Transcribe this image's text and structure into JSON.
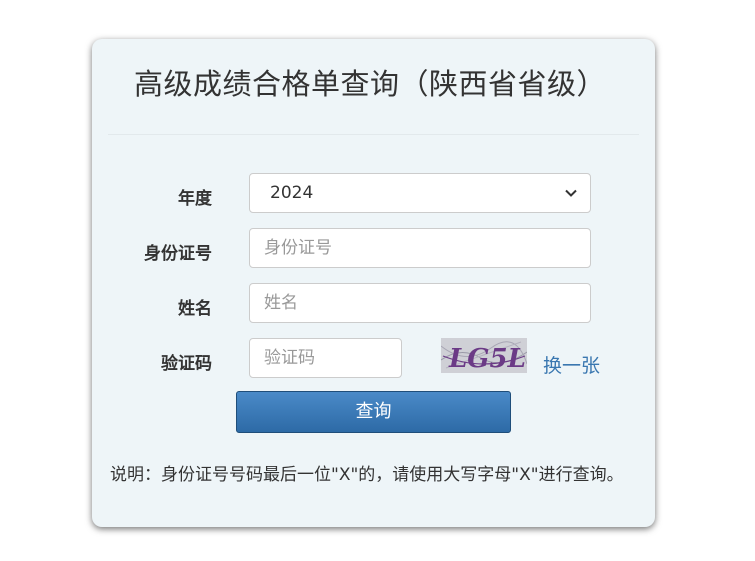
{
  "title": "高级成绩合格单查询（陕西省省级）",
  "form": {
    "year_label": "年度",
    "year_value": "2024",
    "id_label": "身份证号",
    "id_placeholder": "身份证号",
    "name_label": "姓名",
    "name_placeholder": "姓名",
    "captcha_label": "验证码",
    "captcha_placeholder": "验证码",
    "captcha_text": "LG5L",
    "refresh_label": "换一张",
    "submit_label": "查询"
  },
  "note": "说明：身份证号号码最后一位\"X\"的，请使用大写字母\"X\"进行查询。",
  "colors": {
    "panel_bg": "#eef5f8",
    "button_bg": "#2d6aa6",
    "link": "#3a77b0"
  }
}
